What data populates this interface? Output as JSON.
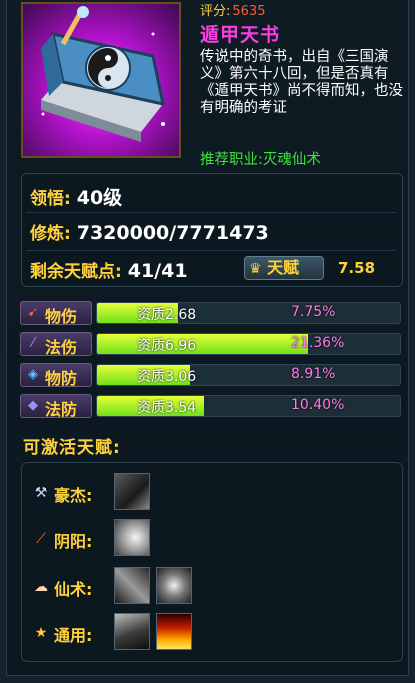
{
  "header": {
    "score_label": "评分:",
    "score_value": "5635",
    "title": "遁甲天书",
    "description": "传说中的奇书，出自《三国演义》第六十八回，但是否真有《遁甲天书》尚不得而知，也没有明确的考证",
    "recommended": "推荐职业:灭魂仙术"
  },
  "info": {
    "comprehension_label": "领悟:",
    "comprehension_value": "40级",
    "cultivation_label": "修炼:",
    "cultivation_value": "7320000/7771473",
    "talent_points_label": "剩余天赋点:",
    "talent_points_value": "41/41",
    "talent_button": "天赋",
    "talent_score": "7.58"
  },
  "attributes": [
    {
      "name": "物伤",
      "aptitude": "资质2.68",
      "percent": "7.75%",
      "fill": 0.268,
      "icon": "sword-icon",
      "icon_color": "#ff5a4c"
    },
    {
      "name": "法伤",
      "aptitude": "资质6.96",
      "percent": "21.36%",
      "fill": 0.696,
      "icon": "wand-icon",
      "icon_color": "#c77cff"
    },
    {
      "name": "物防",
      "aptitude": "资质3.06",
      "percent": "8.91%",
      "fill": 0.306,
      "icon": "shield-icon",
      "icon_color": "#5cc8ff"
    },
    {
      "name": "法防",
      "aptitude": "资质3.54",
      "percent": "10.40%",
      "fill": 0.354,
      "icon": "magic-shield-icon",
      "icon_color": "#9f8cff"
    }
  ],
  "activatable": {
    "title": "可激活天赋:",
    "rows": [
      {
        "label": "豪杰:",
        "icon": "axe-icon"
      },
      {
        "label": "阴阳:",
        "icon": "staff-icon"
      },
      {
        "label": "仙术:",
        "icon": "cloud-icon"
      },
      {
        "label": "通用:",
        "icon": "star-icon"
      }
    ]
  },
  "colors": {
    "gold": "#ffd23c",
    "title_magenta": "#ff3be6",
    "green": "#3fe23b",
    "percent_pink": "#ff7be6"
  }
}
